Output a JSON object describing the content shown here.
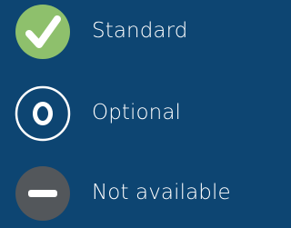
{
  "legend": {
    "items": [
      {
        "label": "Standard",
        "icon": "check-icon",
        "color": "#8ec06c"
      },
      {
        "label": "Optional",
        "icon": "o-icon",
        "color": "#ffffff"
      },
      {
        "label": "Not available",
        "icon": "minus-icon",
        "color": "#53575b"
      }
    ]
  },
  "colors": {
    "background": "#0d4572",
    "text": "#ffffff"
  }
}
